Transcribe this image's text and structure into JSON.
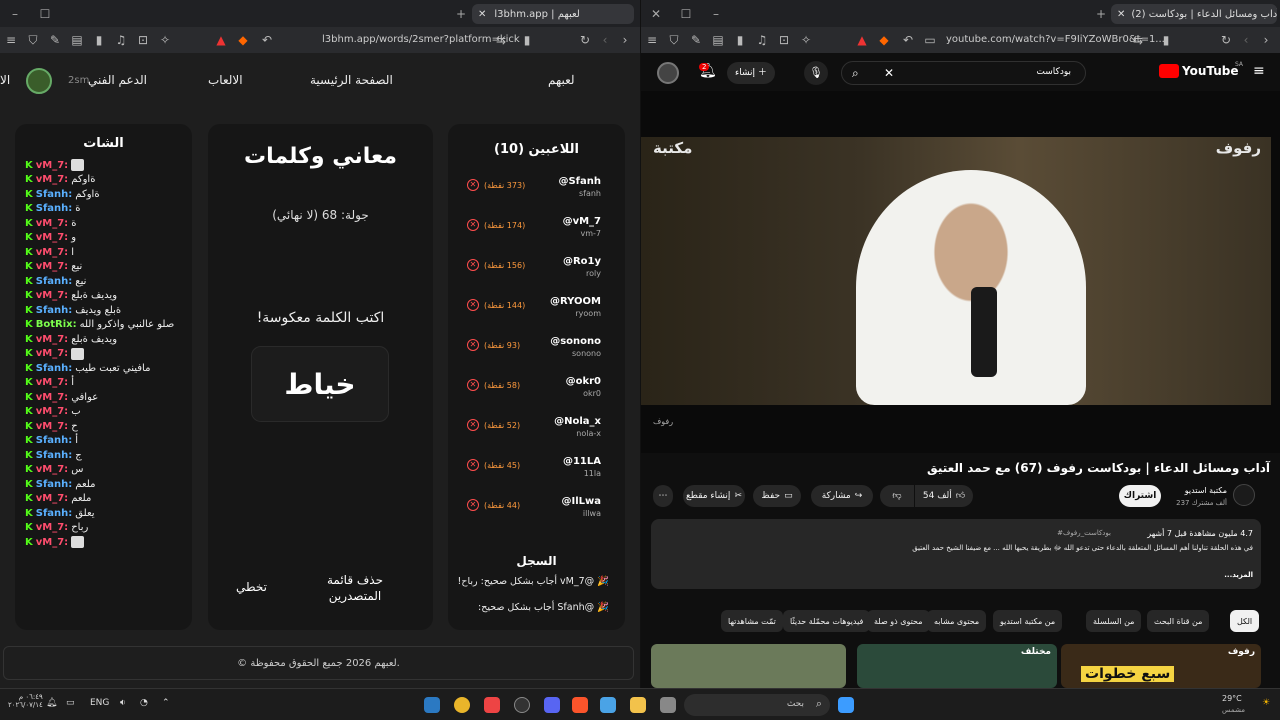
{
  "left_browser": {
    "tab_title": "l3bhm.app | لعبهم",
    "url": "l3bhm.app/words/2smer?platform=kick",
    "nav": {
      "logo": "لعبهم",
      "home": "الصفحة الرئيسية",
      "games": "الالعاب",
      "support": "الدعم الفني",
      "user": "2sm",
      "edge": "الا"
    },
    "chat": {
      "title": "الشات",
      "lines": [
        {
          "user": "vM_7:",
          "cls": "u1",
          "text": ""
        },
        {
          "user": "vM_7:",
          "cls": "u1",
          "text": "ةاوكم"
        },
        {
          "user": "Sfanh:",
          "cls": "u2",
          "text": "ةاوكم"
        },
        {
          "user": "Sfanh:",
          "cls": "u2",
          "text": "ة"
        },
        {
          "user": "vM_7:",
          "cls": "u1",
          "text": "ة"
        },
        {
          "user": "vM_7:",
          "cls": "u1",
          "text": "و"
        },
        {
          "user": "vM_7:",
          "cls": "u1",
          "text": "ا"
        },
        {
          "user": "vM_7:",
          "cls": "u1",
          "text": "نيع"
        },
        {
          "user": "Sfanh:",
          "cls": "u2",
          "text": "نيع"
        },
        {
          "user": "vM_7:",
          "cls": "u1",
          "text": "ويديف ةبلع"
        },
        {
          "user": "Sfanh:",
          "cls": "u2",
          "text": "ةبلع ويديف"
        },
        {
          "user": "BotRix:",
          "cls": "u3",
          "text": "صلو عالنبي واذكرو الله"
        },
        {
          "user": "vM_7:",
          "cls": "u1",
          "text": "ويديف ةبلع"
        },
        {
          "user": "vM_7:",
          "cls": "u1",
          "text": ""
        },
        {
          "user": "Sfanh:",
          "cls": "u2",
          "text": "مافيني تعبت طيب"
        },
        {
          "user": "vM_7:",
          "cls": "u1",
          "text": "أ"
        },
        {
          "user": "vM_7:",
          "cls": "u1",
          "text": "عوافي"
        },
        {
          "user": "vM_7:",
          "cls": "u1",
          "text": "ب"
        },
        {
          "user": "vM_7:",
          "cls": "u1",
          "text": "ح"
        },
        {
          "user": "Sfanh:",
          "cls": "u2",
          "text": "أ"
        },
        {
          "user": "Sfanh:",
          "cls": "u2",
          "text": "ج"
        },
        {
          "user": "vM_7:",
          "cls": "u1",
          "text": "س"
        },
        {
          "user": "Sfanh:",
          "cls": "u2",
          "text": "ملعم"
        },
        {
          "user": "vM_7:",
          "cls": "u1",
          "text": "ملعم"
        },
        {
          "user": "Sfanh:",
          "cls": "u2",
          "text": "يعلق"
        },
        {
          "user": "vM_7:",
          "cls": "u1",
          "text": "رباح"
        },
        {
          "user": "vM_7:",
          "cls": "u1",
          "text": ""
        }
      ]
    },
    "game": {
      "title": "معاني وكلمات",
      "round": "جولة: 68 (لا نهائي)",
      "prompt": "اكتب الكلمة معكوسة!",
      "word": "خياط",
      "skip": "تخطي",
      "clear_leaderboard": "حذف قائمة المتصدرين"
    },
    "players": {
      "title": "اللاعبين (10)",
      "list": [
        {
          "name": "@Sfanh",
          "sub": "sfanh",
          "score": "(373 نقطة)"
        },
        {
          "name": "@vM_7",
          "sub": "vm-7",
          "score": "(174 نقطة)"
        },
        {
          "name": "@Ro1y",
          "sub": "roly",
          "score": "(156 نقطة)"
        },
        {
          "name": "@RYOOM",
          "sub": "ryoom",
          "score": "(144 نقطة)"
        },
        {
          "name": "@sonono",
          "sub": "sonono",
          "score": "(93 نقطة)"
        },
        {
          "name": "@okr0",
          "sub": "okr0",
          "score": "(58 نقطة)"
        },
        {
          "name": "@Nola_x",
          "sub": "nola-x",
          "score": "(52 نقطة)"
        },
        {
          "name": "@11LA",
          "sub": "11la",
          "score": "(45 نقطة)"
        },
        {
          "name": "@IlLwa",
          "sub": "illwa",
          "score": "(44 نقطة)"
        }
      ],
      "log_title": "السجل",
      "log": [
        "🎉 @vM_7 أجاب بشكل صحيح: رباح!",
        "🎉 @Sfanh أجاب بشكل صحيح:"
      ]
    },
    "footer": "© لعبهم 2026 جميع الحقوق محفوظة."
  },
  "right_browser": {
    "tab_title": "(2) آداب ومسائل الدعاء | بودكاست",
    "url": "youtube.com/watch?v=F9IiYZoWBr0&t=1...",
    "header": {
      "logo": "YouTube",
      "region": "SA",
      "search_value": "بودكاست",
      "create": "إنشاء",
      "notif_count": "2"
    },
    "video": {
      "watermark_left": "مكتبة",
      "watermark_right": "رفوف",
      "caption_badge": "رفوف",
      "title": "آداب ومسائل الدعاء | بودكاست رفوف (67) مع حمد العتيق",
      "channel": "مكتبة استديو",
      "subs": "237 ألف مشترك",
      "subscribe": "اشتراك",
      "likes": "54 ألف",
      "share": "مشاركة",
      "save": "حفظ",
      "clip": "إنشاء مقطع",
      "views": "4.7 مليون مشاهدة قبل 7 أشهر",
      "tags": "#بودكاست_رفوف",
      "desc": "في هذه الحلقة تناولنا أهم المسائل المتعلقة بالدعاء حتى تدعو الله ﷻ بطريقة يحبها الله ... مع ضيفنا الشيخ حمد العتيق",
      "more": "...المزيد"
    },
    "chips": [
      "الكل",
      "من قناة البحث",
      "من السلسلة",
      "من مكتبة استديو",
      "محتوى مشابه",
      "محتوى ذو صلة",
      "فيديوهات محمّلة حديثًا",
      "تمّت مشاهدتها"
    ],
    "thumbs": [
      {
        "label": "رفوف",
        "text": "سبع خطوات",
        "color": "#3a2a18"
      },
      {
        "label": "مختلف",
        "text": "",
        "color": "#2b4a3a"
      },
      {
        "label": "",
        "text": "",
        "color": "#6b7a5a"
      }
    ]
  },
  "taskbar": {
    "search": "بحث",
    "lang": "ENG",
    "time": "٠٦:٤٩ م",
    "date": "٢٠٢٦/٠٧/١٤",
    "weather_temp": "29°C",
    "weather_desc": "مشمس"
  }
}
